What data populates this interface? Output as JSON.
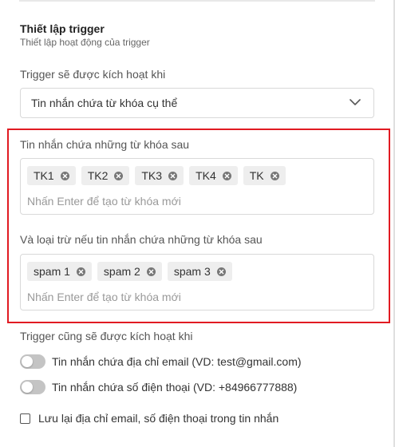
{
  "section": {
    "title": "Thiết lập trigger",
    "subtitle": "Thiết lập hoạt động của trigger"
  },
  "trigger_when": {
    "label": "Trigger sẽ được kích hoạt khi",
    "selected": "Tin nhắn chứa từ khóa cụ thể",
    "icon": "chevron-down-icon"
  },
  "keywords": {
    "label": "Tin nhắn chứa những từ khóa sau",
    "tags": [
      "TK1",
      "TK2",
      "TK3",
      "TK4",
      "TK"
    ],
    "placeholder": "Nhấn Enter để tạo từ khóa mới"
  },
  "exclude": {
    "label": "Và loại trừ nếu tin nhắn chứa những từ khóa sau",
    "tags": [
      "spam 1",
      "spam 2",
      "spam 3"
    ],
    "placeholder": "Nhấn Enter để tạo từ khóa mới"
  },
  "also_trigger": {
    "label": "Trigger cũng sẽ được kích hoạt khi",
    "email_toggle": {
      "label": "Tin nhắn chứa địa chỉ email (VD: test@gmail.com)",
      "on": false
    },
    "phone_toggle": {
      "label": "Tin nhắn chứa số điện thoại (VD: +84966777888)",
      "on": false
    }
  },
  "save_contact": {
    "label": "Lưu lại địa chỉ email, số điện thoại trong tin nhắn",
    "checked": false
  },
  "colors": {
    "highlight": "#e11b22",
    "tag_bg": "#eeeeee",
    "toggle_off": "#c4c4c4"
  }
}
